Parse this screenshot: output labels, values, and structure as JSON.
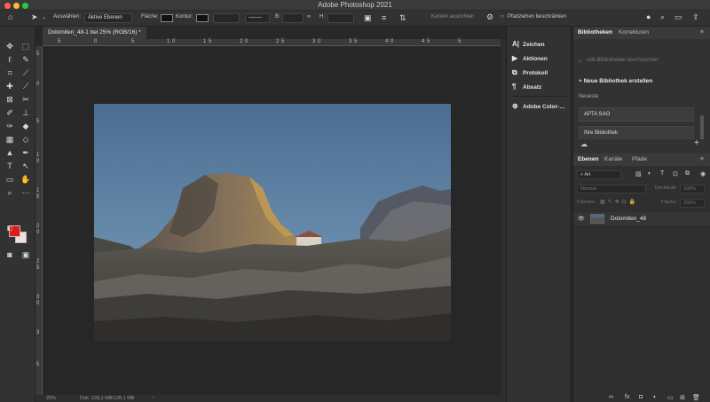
{
  "window": {
    "title": "Adobe Photoshop 2021"
  },
  "options_bar": {
    "select_label": "Auswählen:",
    "select_value": "Aktive Ebenen",
    "fill_label": "Fläche:",
    "stroke_label": "Kontur:",
    "w_label": "B:",
    "h_label": "H:",
    "align_edges": "Kanten ausrichten",
    "constrain_path": "Pfadziehen beschränken"
  },
  "document": {
    "tab_title": "Dolomiten_48-1 bei 25% (RGB/16) *"
  },
  "rulers": {
    "top": [
      "5",
      "0",
      "5",
      "1",
      "0",
      "1",
      "5",
      "2",
      "0",
      "2",
      "5",
      "3",
      "0",
      "3",
      "5",
      "4",
      "0",
      "4",
      "5",
      "5"
    ],
    "left": [
      "5",
      "0",
      "5",
      "1",
      "0",
      "1",
      "5",
      "2",
      "0",
      "2",
      "5",
      "3",
      "0",
      "3",
      "5"
    ]
  },
  "status": {
    "zoom": "25%",
    "doc_info": "Dok: 128,1 MB/128,1 MB"
  },
  "dock": {
    "items": [
      {
        "label": "Zeichen",
        "icon": "character-icon"
      },
      {
        "label": "Aktionen",
        "icon": "play-icon"
      },
      {
        "label": "Protokoll",
        "icon": "history-icon"
      },
      {
        "label": "Absatz",
        "icon": "paragraph-icon"
      },
      {
        "label": "Adobe Color-…",
        "icon": "color-wheel-icon"
      }
    ]
  },
  "libraries_panel": {
    "tabs": [
      "Bibliotheken",
      "Korrekturen"
    ],
    "search_placeholder": "Alle Bibliotheken durchsuchen",
    "new_library": "Neue Bibliothek erstellen",
    "recent_label": "Neueste",
    "libraries": [
      "APTA SAO",
      "Ihre Bibliothek"
    ]
  },
  "layers_panel": {
    "tabs": [
      "Ebenen",
      "Kanäle",
      "Pfade"
    ],
    "filter_value": "Art",
    "blend_mode": "Normal",
    "opacity_label": "Deckkraft:",
    "opacity_value": "100%",
    "lock_label": "Fixieren:",
    "fill_label": "Fläche:",
    "fill_value": "100%",
    "layers": [
      {
        "name": "Dolomiten_48",
        "visible": true
      }
    ]
  },
  "colors": {
    "foreground": "#e01818",
    "background": "#f3dcdc"
  }
}
